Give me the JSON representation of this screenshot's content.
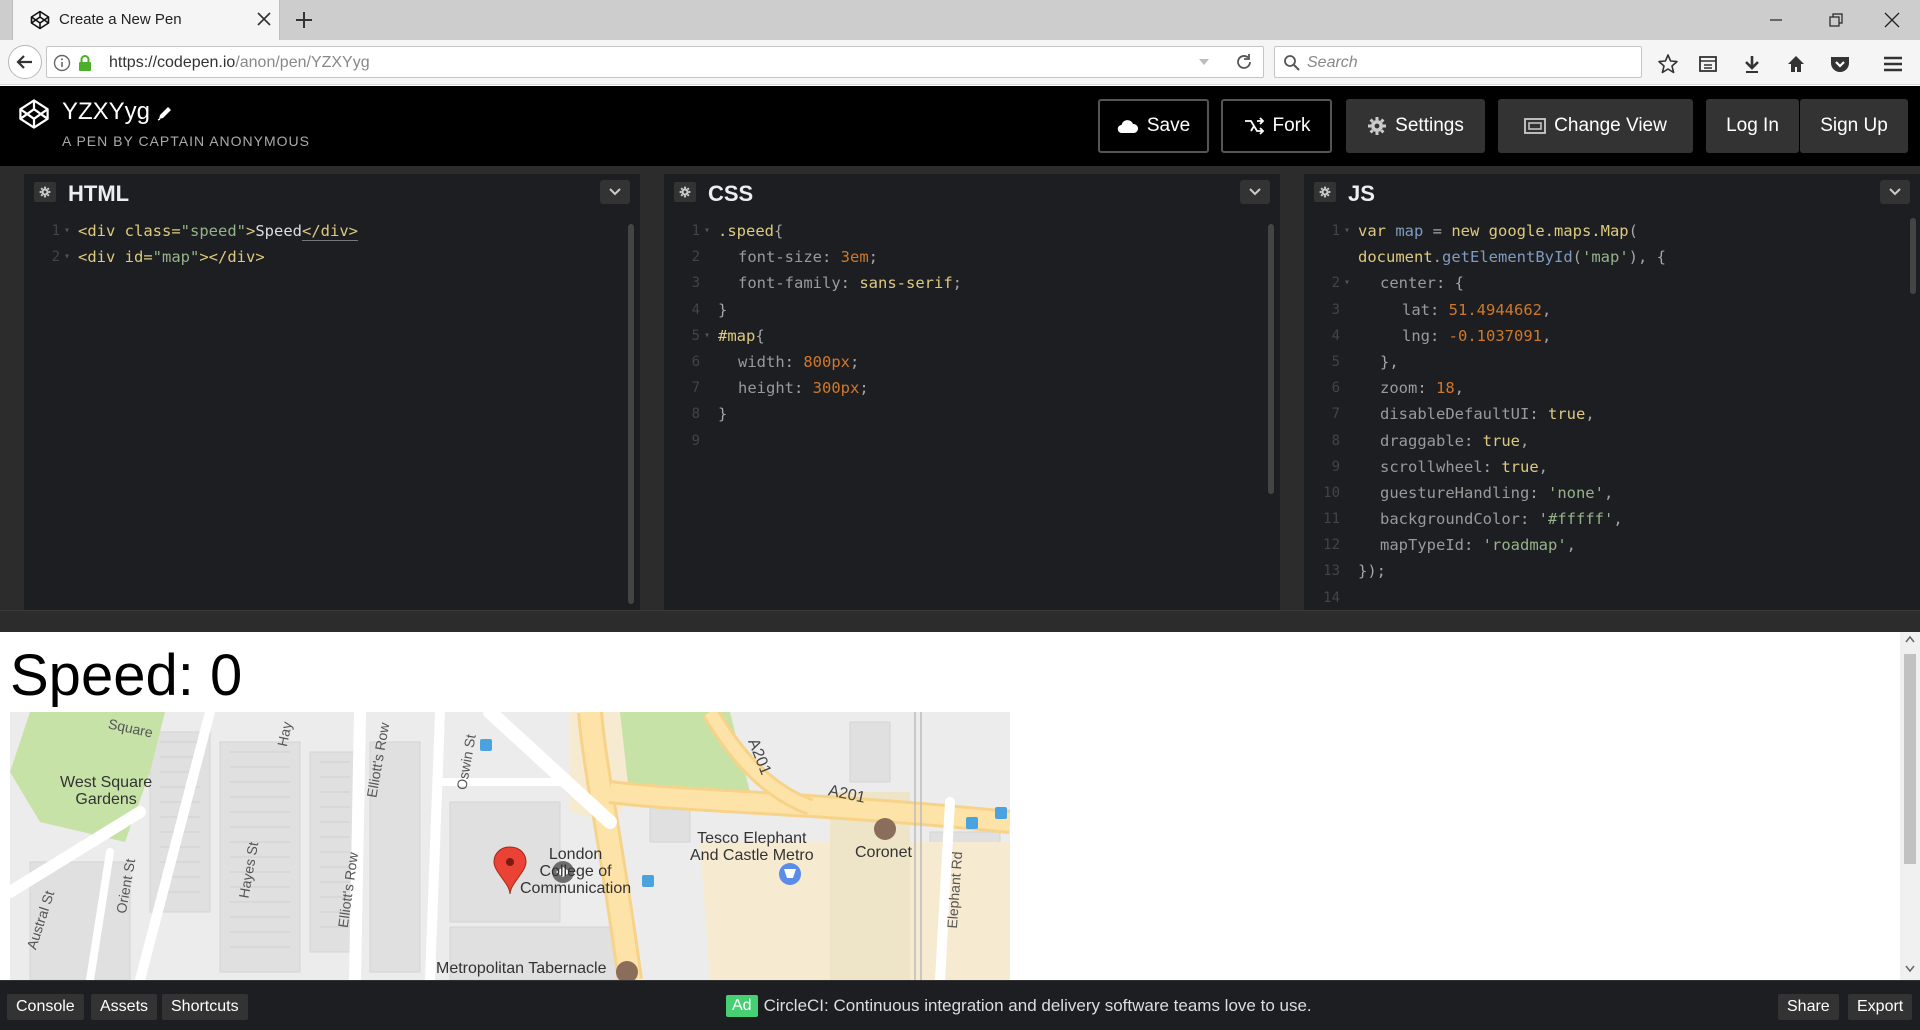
{
  "browser": {
    "tab_title": "Create a New Pen",
    "url_main": "https://codepen.io",
    "url_path": "/anon/pen/YZXYyg",
    "search_placeholder": "Search"
  },
  "codepen": {
    "pen_title": "YZXYyg",
    "pen_author": "A PEN BY CAPTAIN ANONYMOUS",
    "buttons": {
      "save": "Save",
      "fork": "Fork",
      "settings": "Settings",
      "change_view": "Change View",
      "login": "Log In",
      "signup": "Sign Up"
    }
  },
  "editors": {
    "html": {
      "name": "HTML",
      "line_numbers": [
        "1",
        "2"
      ]
    },
    "css": {
      "name": "CSS",
      "line_numbers": [
        "1",
        "2",
        "3",
        "4",
        "5",
        "6",
        "7",
        "8",
        "9"
      ]
    },
    "js": {
      "name": "JS",
      "line_numbers": [
        "1",
        "",
        "2",
        "3",
        "4",
        "5",
        "6",
        "7",
        "8",
        "9",
        "10",
        "11",
        "12",
        "13",
        "14"
      ]
    }
  },
  "html_code": {
    "l1_open": "<div ",
    "l1_attr": "class=",
    "l1_val": "\"speed\"",
    "l1_gt": ">",
    "l1_text": "Speed",
    "l1_close": "</div>",
    "l2_open": "<div ",
    "l2_attr": "id=",
    "l2_val": "\"map\"",
    "l2_rest": "></div>"
  },
  "css_code": {
    "l1_sel": ".speed",
    "l1_brace": "{",
    "l2_prop": "font-size",
    "l2_colon": ": ",
    "l2_val": "3em",
    "l2_semi": ";",
    "l3_prop": "font-family",
    "l3_colon": ": ",
    "l3_val": "sans-serif",
    "l3_semi": ";",
    "l4": "}",
    "l5_sel": "#map",
    "l5_brace": "{",
    "l6_prop": "width",
    "l6_colon": ": ",
    "l6_val": "800px",
    "l6_semi": ";",
    "l7_prop": "height",
    "l7_colon": ": ",
    "l7_val": "300px",
    "l7_semi": ";",
    "l8": "}"
  },
  "js_code": {
    "l1_kw": "var ",
    "l1_var": "map",
    "l1_eq": " = ",
    "l1_new": "new ",
    "l1_fn": "google.maps.Map",
    "l1_paren": "(",
    "l1b_obj": "document",
    "l1b_dot": ".",
    "l1b_fn": "getElementById",
    "l1b_open": "(",
    "l1b_str": "'map'",
    "l1b_rest": "), {",
    "l2_prop": "center",
    "l2_rest": ": {",
    "l3_prop": "lat",
    "l3_colon": ": ",
    "l3_val": "51.4944662",
    "l3_comma": ",",
    "l4_prop": "lng",
    "l4_colon": ": ",
    "l4_val": "-0.1037091",
    "l4_comma": ",",
    "l5": "},",
    "l6_prop": "zoom",
    "l6_colon": ": ",
    "l6_val": "18",
    "l6_comma": ",",
    "l7_prop": "disableDefaultUI",
    "l7_colon": ": ",
    "l7_val": "true",
    "l7_comma": ",",
    "l8_prop": "draggable",
    "l8_colon": ": ",
    "l8_val": "true",
    "l8_comma": ",",
    "l9_prop": "scrollwheel",
    "l9_colon": ": ",
    "l9_val": "true",
    "l9_comma": ",",
    "l10_prop": "guestureHandling",
    "l10_colon": ": ",
    "l10_val": "'none'",
    "l10_comma": ",",
    "l11_prop": "backgroundColor",
    "l11_colon": ": ",
    "l11_val": "'#fffff'",
    "l11_comma": ",",
    "l12_prop": "mapTypeId",
    "l12_colon": ": ",
    "l12_val": "'roadmap'",
    "l12_comma": ",",
    "l13": "});"
  },
  "result": {
    "speed_text": "Speed: 0"
  },
  "map": {
    "labels": {
      "park": "West Square\nGardens",
      "college": "London\nCollege of\nCommunication",
      "tesco": "Tesco Elephant\nAnd Castle Metro",
      "coronet": "Coronet",
      "tabernacle": "Metropolitan Tabernacle"
    },
    "streets": {
      "square": "Square",
      "oswin": "Oswin St",
      "hayles1": "Hay",
      "elliotts1": "Elliott's Row",
      "hayes": "Hayes St",
      "orient": "Orient St",
      "austral": "Austral St",
      "elliotts2": "Elliott's Row",
      "a201a": "A201",
      "a201b": "A201",
      "elephant": "Elephant Rd"
    }
  },
  "footer": {
    "console": "Console",
    "assets": "Assets",
    "shortcuts": "Shortcuts",
    "ad_badge": "Ad",
    "ad_text": "CircleCI: Continuous integration and delivery software teams love to use.",
    "share": "Share",
    "export": "Export"
  },
  "colors": {
    "accent_green": "#47cf73",
    "editor_bg": "#1d1e22",
    "header_bg": "#000000"
  }
}
